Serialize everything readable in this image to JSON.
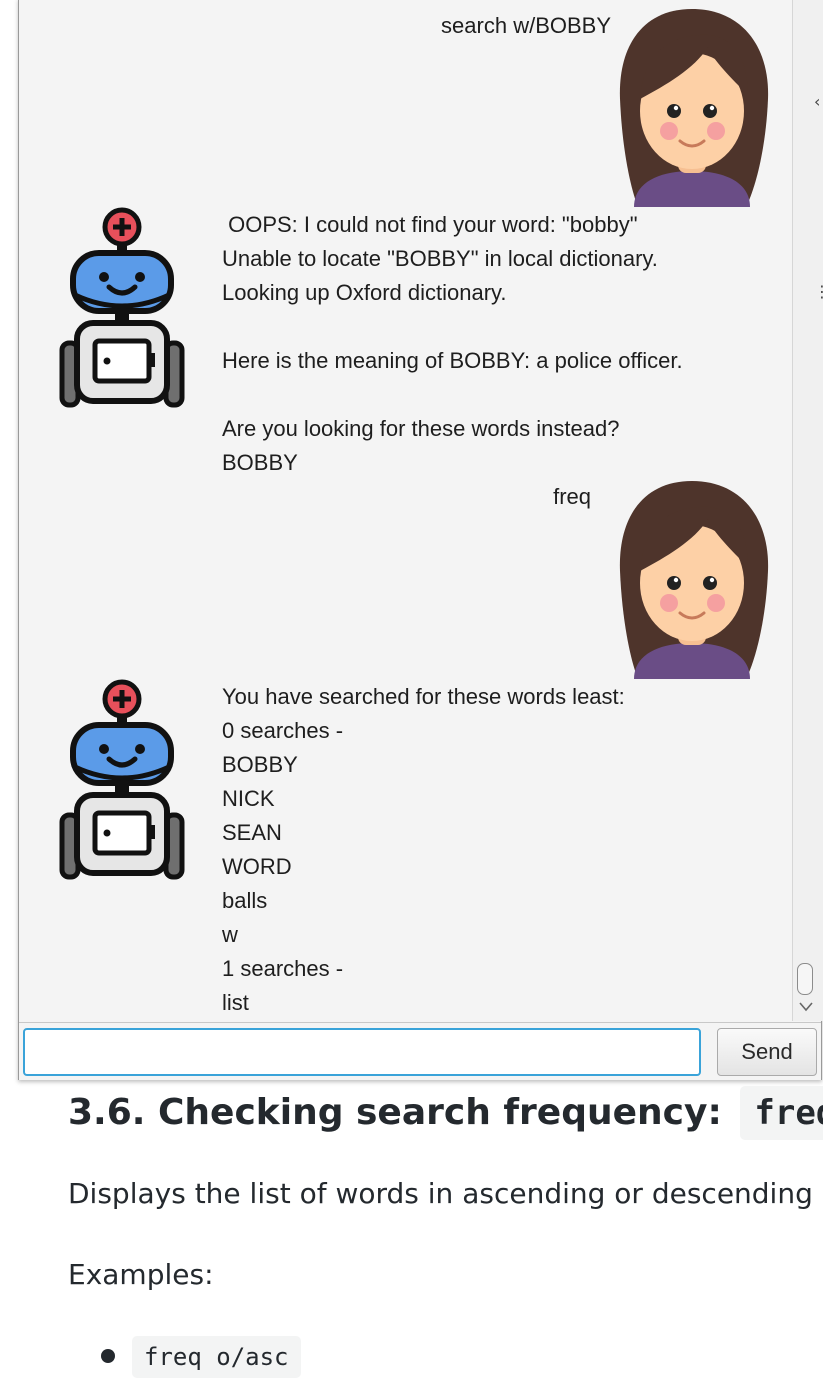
{
  "chat": {
    "messages": [
      {
        "sender": "user",
        "avatar": "girl-avatar-icon",
        "text": "search w/BOBBY"
      },
      {
        "sender": "bot",
        "avatar": "robot-avatar-icon",
        "text": " OOPS: I could not find your word: \"bobby\"\nUnable to locate \"BOBBY\" in local dictionary.\nLooking up Oxford dictionary.\n\nHere is the meaning of BOBBY: a police officer.\n\nAre you looking for these words instead?\nBOBBY"
      },
      {
        "sender": "user",
        "avatar": "girl-avatar-icon",
        "text": "freq"
      },
      {
        "sender": "bot",
        "avatar": "robot-avatar-icon",
        "text": "You have searched for these words least:\n0 searches -\nBOBBY\nNICK\nSEAN\nWORD\nballs\nw\n1 searches -\nlist"
      }
    ]
  },
  "input": {
    "value": "",
    "placeholder": ""
  },
  "send_label": "Send",
  "doc": {
    "heading_text": "3.6. Checking search frequency:",
    "heading_code": "freq",
    "description": "Displays the list of words in ascending or descending",
    "examples_label": "Examples:",
    "examples": [
      "freq o/asc"
    ]
  },
  "colors": {
    "chat_background": "#f4f4f4",
    "input_focus_border": "#3aa3d9",
    "robot_head": "#5b9be8",
    "robot_antenna": "#e8505b",
    "girl_hair": "#4e342b",
    "girl_shirt": "#6a4d86"
  }
}
